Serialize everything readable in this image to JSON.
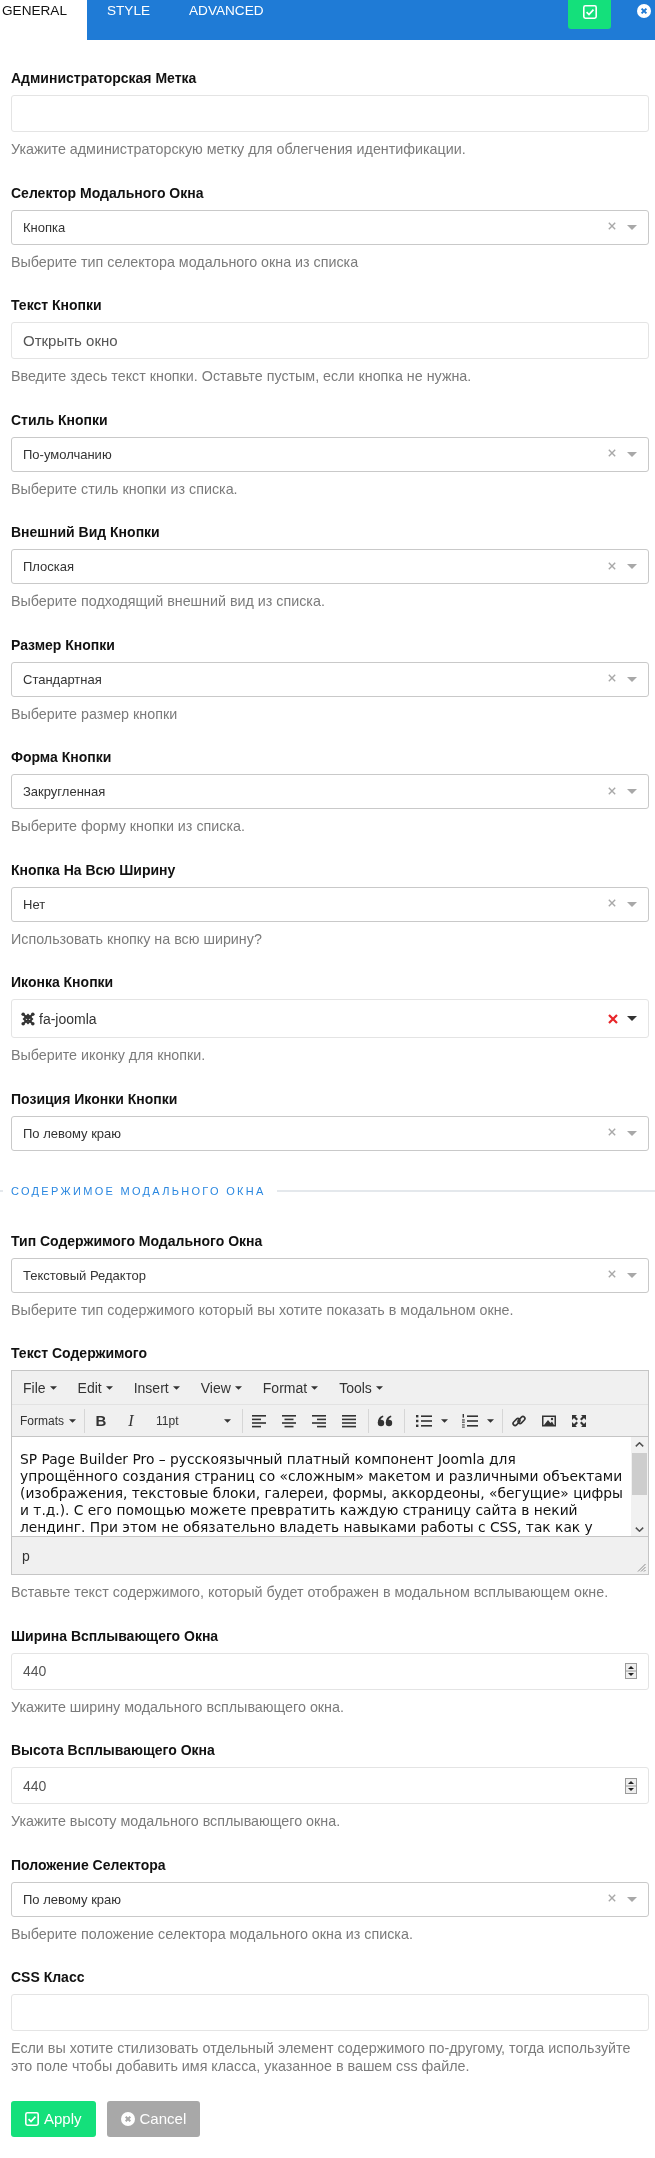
{
  "tabs": [
    {
      "label": "GENERAL",
      "selected": true
    },
    {
      "label": "STYLE",
      "selected": false
    },
    {
      "label": "ADVANCED",
      "selected": false
    }
  ],
  "fields": [
    {
      "kind": "text",
      "label": "Администраторская Метка",
      "help": "Укажите администраторскую метку для облегчения идентификации."
    },
    {
      "kind": "select",
      "label": "Селектор Модального Окна",
      "value": "Кнопка",
      "help": "Выберите тип селектора модального окна из списка"
    },
    {
      "kind": "text",
      "label": "Текст Кнопки",
      "value": "Открыть окно",
      "help": "Введите здесь текст кнопки. Оставьте пустым, если кнопка не нужна."
    },
    {
      "kind": "select",
      "label": "Стиль Кнопки",
      "value": "По-умолчанию",
      "help": "Выберите стиль кнопки из списка."
    },
    {
      "kind": "select",
      "label": "Внешний Вид Кнопки",
      "value": "Плоская",
      "help": "Выберите подходящий внешний вид из списка."
    },
    {
      "kind": "select",
      "label": "Размер Кнопки",
      "value": "Стандартная",
      "help": "Выберите размер кнопки"
    },
    {
      "kind": "select",
      "label": "Форма Кнопки",
      "value": "Закругленная",
      "help": "Выберите форму кнопки из списка."
    },
    {
      "kind": "select",
      "label": "Кнопка На Всю Ширину",
      "value": "Нет",
      "help": "Использовать кнопку на всю ширину?"
    },
    {
      "kind": "icon-select",
      "label": "Иконка Кнопки",
      "value": "fa-joomla",
      "help": "Выберите иконку для кнопки."
    },
    {
      "kind": "select",
      "label": "Позиция Иконки Кнопки",
      "value": "По левому краю"
    },
    {
      "kind": "section",
      "title": "СОДЕРЖИМОЕ МОДАЛЬНОГО ОКНА"
    },
    {
      "kind": "select",
      "label": "Тип Содержимого Модального Окна",
      "value": "Текстовый Редактор",
      "help": "Выберите тип содержимого который вы хотите показать в модальном окне."
    },
    {
      "kind": "editor",
      "label": "Текст Содержимого",
      "editor": {
        "menu": [
          "File",
          "Edit",
          "Insert",
          "View",
          "Format",
          "Tools"
        ],
        "toolbar": [
          {
            "items": [
              {
                "kind": "formats",
                "label": "Formats"
              }
            ]
          },
          {
            "items": [
              {
                "kind": "bold",
                "label": "B"
              },
              {
                "kind": "italic",
                "label": "I"
              },
              {
                "kind": "font-size",
                "label": "11pt"
              }
            ]
          },
          {
            "items": [
              {
                "kind": "align-left"
              },
              {
                "kind": "align-center"
              },
              {
                "kind": "align-right"
              },
              {
                "kind": "justify"
              }
            ]
          },
          {
            "items": [
              {
                "kind": "blockquote"
              }
            ]
          },
          {
            "items": [
              {
                "kind": "bullet-list"
              },
              {
                "kind": "numbered-list"
              }
            ]
          },
          {
            "items": [
              {
                "kind": "link"
              },
              {
                "kind": "image"
              },
              {
                "kind": "fullscreen"
              }
            ]
          }
        ],
        "lines": [
          "SP Page Builder Pro – русскоязычный платный компонент Joomla для",
          "упрощённого создания страниц со «сложным» макетом и различными объектами",
          "(изображения, текстовые блоки, галереи, формы, аккордеоны, «бегущие» цифры",
          "и т.д.). С его помощью можете превратить каждую страницу сайта в некий",
          "лендинг. При этом не обязательно владеть навыками работы с CSS, так как у"
        ],
        "path": "p"
      },
      "help": "Вставьте текст содержимого, который будет отображен в модальном всплывающем окне."
    },
    {
      "kind": "number",
      "label": "Ширина Всплывающего Окна",
      "value": "440",
      "help": "Укажите ширину модального всплывающего окна."
    },
    {
      "kind": "number",
      "label": "Высота Всплывающего Окна",
      "value": "440",
      "help": "Укажите высоту модального всплывающего окна."
    },
    {
      "kind": "select",
      "label": "Положение Селектора",
      "value": "По левому краю",
      "help": "Выберите положение селектора модального окна из списка."
    },
    {
      "kind": "text",
      "label": "CSS Класс",
      "help": "Если вы хотите стилизовать отдельный элемент содержимого по-другому, тогда используйте это поле чтобы добавить имя класса, указанное в вашем css файле."
    }
  ],
  "buttons": [
    {
      "kind": "apply",
      "label": "Apply"
    },
    {
      "kind": "cancel",
      "label": "Cancel"
    }
  ]
}
